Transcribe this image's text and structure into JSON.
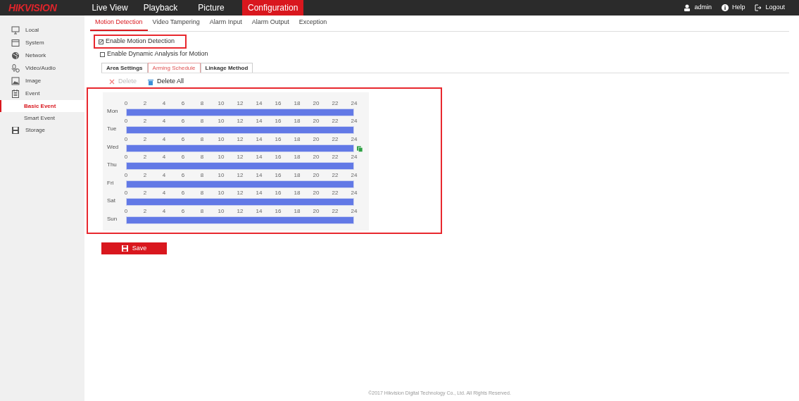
{
  "logo": "HIKVISION",
  "nav": [
    {
      "label": "Live View",
      "selected": false
    },
    {
      "label": "Playback",
      "selected": false
    },
    {
      "label": "Picture",
      "selected": false
    },
    {
      "label": "Configuration",
      "selected": true
    }
  ],
  "user_menu": [
    {
      "kind": "user",
      "label": "admin"
    },
    {
      "kind": "help",
      "label": "Help"
    },
    {
      "kind": "logout",
      "label": "Logout"
    }
  ],
  "sidebar": {
    "items": [
      {
        "kind": "monitor",
        "label": "Local",
        "selected": false
      },
      {
        "kind": "window",
        "label": "System",
        "selected": false
      },
      {
        "kind": "globe",
        "label": "Network",
        "selected": false
      },
      {
        "kind": "mic",
        "label": "Video/Audio",
        "selected": false
      },
      {
        "kind": "image",
        "label": "Image",
        "selected": false
      },
      {
        "kind": "calendar",
        "label": "Event",
        "selected": false,
        "children": [
          {
            "label": "Basic Event",
            "selected": true
          },
          {
            "label": "Smart Event",
            "selected": false
          }
        ]
      },
      {
        "kind": "disk",
        "label": "Storage",
        "selected": false
      }
    ]
  },
  "tabs": [
    {
      "label": "Motion Detection",
      "selected": true
    },
    {
      "label": "Video Tampering",
      "selected": false
    },
    {
      "label": "Alarm Input",
      "selected": false
    },
    {
      "label": "Alarm Output",
      "selected": false
    },
    {
      "label": "Exception",
      "selected": false
    }
  ],
  "options": [
    {
      "label": "Enable Motion Detection",
      "checked": true,
      "highlighted": true
    },
    {
      "label": "Enable Dynamic Analysis for Motion",
      "checked": false,
      "highlighted": false
    }
  ],
  "steps": [
    {
      "label": "Area Settings",
      "selected": false
    },
    {
      "label": "Arming Schedule",
      "selected": true
    },
    {
      "label": "Linkage Method",
      "selected": false
    }
  ],
  "toolbar": [
    {
      "kind": "delete",
      "label": "Delete",
      "disabled": true
    },
    {
      "kind": "delete-all",
      "label": "Delete All",
      "disabled": false
    }
  ],
  "schedule": {
    "highlighted": true,
    "days": [
      {
        "day": "Mon",
        "level": 1,
        "hovered": false,
        "hours": [
          "0",
          "2",
          "4",
          "6",
          "8",
          "10",
          "12",
          "14",
          "16",
          "18",
          "20",
          "22",
          "24"
        ]
      },
      {
        "day": "Tue",
        "level": 1,
        "hovered": false,
        "hours": [
          "0",
          "2",
          "4",
          "6",
          "8",
          "10",
          "12",
          "14",
          "16",
          "18",
          "20",
          "22",
          "24"
        ]
      },
      {
        "day": "Wed",
        "level": 1,
        "hovered": true,
        "hours": [
          "0",
          "2",
          "4",
          "6",
          "8",
          "10",
          "12",
          "14",
          "16",
          "18",
          "20",
          "22",
          "24"
        ]
      },
      {
        "day": "Thu",
        "level": 1,
        "hovered": false,
        "hours": [
          "0",
          "2",
          "4",
          "6",
          "8",
          "10",
          "12",
          "14",
          "16",
          "18",
          "20",
          "22",
          "24"
        ]
      },
      {
        "day": "Fri",
        "level": 1,
        "hovered": false,
        "hours": [
          "0",
          "2",
          "4",
          "6",
          "8",
          "10",
          "12",
          "14",
          "16",
          "18",
          "20",
          "22",
          "24"
        ]
      },
      {
        "day": "Sat",
        "level": 1,
        "hovered": false,
        "hours": [
          "0",
          "2",
          "4",
          "6",
          "8",
          "10",
          "12",
          "14",
          "16",
          "18",
          "20",
          "22",
          "24"
        ]
      },
      {
        "day": "Sun",
        "level": 1,
        "hovered": false,
        "hours": [
          "0",
          "2",
          "4",
          "6",
          "8",
          "10",
          "12",
          "14",
          "16",
          "18",
          "20",
          "22",
          "24"
        ]
      }
    ]
  },
  "save_button": "Save",
  "footer": "©2017 Hikvision Digital Technology Co., Ltd. All Rights Reserved."
}
